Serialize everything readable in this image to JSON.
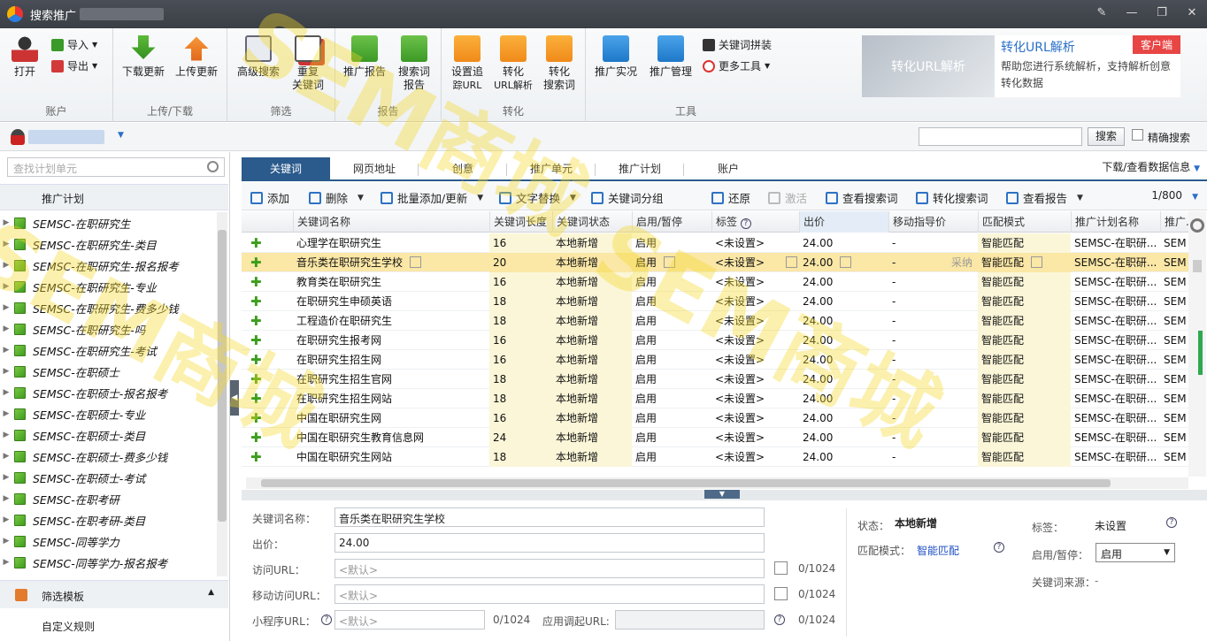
{
  "window": {
    "title": "搜索推广",
    "controls": [
      "edit",
      "minimize",
      "restore",
      "close"
    ]
  },
  "ribbon": {
    "groups": [
      {
        "label": "账户",
        "buttons": [
          "打开"
        ],
        "small": [
          "导入",
          "导出"
        ]
      },
      {
        "label": "上传/下载",
        "buttons": [
          "下载更新",
          "上传更新"
        ]
      },
      {
        "label": "筛选",
        "buttons": [
          "高级搜索",
          "重复关键词"
        ]
      },
      {
        "label": "报告",
        "buttons": [
          "推广报告",
          "搜索词报告"
        ]
      },
      {
        "label": "转化",
        "buttons": [
          "设置追踪URL",
          "转化URL解析",
          "转化搜索词"
        ]
      },
      {
        "label": "工具",
        "buttons": [
          "推广实况",
          "推广管理"
        ],
        "small": [
          "关键词拼装",
          "更多工具"
        ]
      }
    ],
    "btn": {
      "open": "打开",
      "import": "导入",
      "export": "导出",
      "download": "下载更新",
      "upload": "上传更新",
      "adv_search_1": "高级搜索",
      "dup_1": "重复",
      "dup_2": "关键词",
      "report": "推广报告",
      "sw_report_1": "搜索词",
      "sw_report_2": "报告",
      "track_1": "设置追",
      "track_2": "踪URL",
      "conv_url_1": "转化",
      "conv_url_2": "URL解析",
      "conv_sw_1": "转化",
      "conv_sw_2": "搜索词",
      "live": "推广实况",
      "manage": "推广管理",
      "kw_assemble": "关键词拼装",
      "more_tools": "更多工具"
    },
    "labels": {
      "account": "账户",
      "updown": "上传/下载",
      "filter": "筛选",
      "report": "报告",
      "convert": "转化",
      "tools": "工具"
    },
    "promo": {
      "image_text": "转化URL解析",
      "title": "转化URL解析",
      "badge": "客户端",
      "text": "帮助您进行系统解析，支持解析创意转化数据"
    }
  },
  "account_bar": {
    "search_button": "搜索",
    "exact_label": "精确搜索"
  },
  "sidebar": {
    "search_placeholder": "查找计划单元",
    "plan_header": "推广计划",
    "plans": [
      "SEMSC-在职研究生",
      "SEMSC-在职研究生-类目",
      "SEMSC-在职研究生-报名报考",
      "SEMSC-在职研究生-专业",
      "SEMSC-在职研究生-费多少钱",
      "SEMSC-在职研究生-吗",
      "SEMSC-在职研究生-考试",
      "SEMSC-在职硕士",
      "SEMSC-在职硕士-报名报考",
      "SEMSC-在职硕士-专业",
      "SEMSC-在职硕士-类目",
      "SEMSC-在职硕士-费多少钱",
      "SEMSC-在职硕士-考试",
      "SEMSC-在职考研",
      "SEMSC-在职考研-类目",
      "SEMSC-同等学力",
      "SEMSC-同等学力-报名报考"
    ],
    "filter_header": "筛选模板",
    "custom_rule": "自定义规则"
  },
  "tabs": [
    {
      "label": "关键词",
      "active": true
    },
    {
      "label": "网页地址"
    },
    {
      "label": "创意"
    },
    {
      "label": "推广单元"
    },
    {
      "label": "推广计划"
    },
    {
      "label": "账户"
    }
  ],
  "tabs_right": "下载/查看数据信息",
  "toolbar": {
    "add": "添加",
    "delete": "删除",
    "batch_add": "批量添加/更新",
    "text_replace": "文字替换",
    "kw_group": "关键词分组",
    "restore": "还原",
    "activate": "激活",
    "view_sw": "查看搜索词",
    "conv_sw": "转化搜索词",
    "view_report": "查看报告",
    "pager": "1/800"
  },
  "grid": {
    "headers": [
      "关键词名称",
      "关键词长度",
      "关键词状态",
      "启用/暂停",
      "标签",
      "出价",
      "移动指导价",
      "匹配模式",
      "推广计划名称",
      "推广..."
    ],
    "rows": [
      {
        "kw": "心理学在职研究生",
        "len": "16",
        "status": "本地新增",
        "enabled": "启用",
        "tag": "<未设置>",
        "bid": "24.00",
        "mobile": "-",
        "match": "智能匹配",
        "plan": "SEMSC-在职研...",
        "unit": "SEM"
      },
      {
        "kw": "音乐类在职研究生学校",
        "len": "20",
        "status": "本地新增",
        "enabled": "启用",
        "tag": "<未设置>",
        "bid": "24.00",
        "mobile": "-",
        "match": "智能匹配",
        "plan": "SEMSC-在职研...",
        "unit": "SEM",
        "selected": true,
        "extra": "采纳"
      },
      {
        "kw": "教育类在职研究生",
        "len": "16",
        "status": "本地新增",
        "enabled": "启用",
        "tag": "<未设置>",
        "bid": "24.00",
        "mobile": "-",
        "match": "智能匹配",
        "plan": "SEMSC-在职研...",
        "unit": "SEM"
      },
      {
        "kw": "在职研究生申硕英语",
        "len": "18",
        "status": "本地新增",
        "enabled": "启用",
        "tag": "<未设置>",
        "bid": "24.00",
        "mobile": "-",
        "match": "智能匹配",
        "plan": "SEMSC-在职研...",
        "unit": "SEM"
      },
      {
        "kw": "工程造价在职研究生",
        "len": "18",
        "status": "本地新增",
        "enabled": "启用",
        "tag": "<未设置>",
        "bid": "24.00",
        "mobile": "-",
        "match": "智能匹配",
        "plan": "SEMSC-在职研...",
        "unit": "SEM"
      },
      {
        "kw": "在职研究生报考网",
        "len": "16",
        "status": "本地新增",
        "enabled": "启用",
        "tag": "<未设置>",
        "bid": "24.00",
        "mobile": "-",
        "match": "智能匹配",
        "plan": "SEMSC-在职研...",
        "unit": "SEM"
      },
      {
        "kw": "在职研究生招生网",
        "len": "16",
        "status": "本地新增",
        "enabled": "启用",
        "tag": "<未设置>",
        "bid": "24.00",
        "mobile": "-",
        "match": "智能匹配",
        "plan": "SEMSC-在职研...",
        "unit": "SEM"
      },
      {
        "kw": "在职研究生招生官网",
        "len": "18",
        "status": "本地新增",
        "enabled": "启用",
        "tag": "<未设置>",
        "bid": "24.00",
        "mobile": "-",
        "match": "智能匹配",
        "plan": "SEMSC-在职研...",
        "unit": "SEM"
      },
      {
        "kw": "在职研究生招生网站",
        "len": "18",
        "status": "本地新增",
        "enabled": "启用",
        "tag": "<未设置>",
        "bid": "24.00",
        "mobile": "-",
        "match": "智能匹配",
        "plan": "SEMSC-在职研...",
        "unit": "SEM"
      },
      {
        "kw": "中国在职研究生网",
        "len": "16",
        "status": "本地新增",
        "enabled": "启用",
        "tag": "<未设置>",
        "bid": "24.00",
        "mobile": "-",
        "match": "智能匹配",
        "plan": "SEMSC-在职研...",
        "unit": "SEM"
      },
      {
        "kw": "中国在职研究生教育信息网",
        "len": "24",
        "status": "本地新增",
        "enabled": "启用",
        "tag": "<未设置>",
        "bid": "24.00",
        "mobile": "-",
        "match": "智能匹配",
        "plan": "SEMSC-在职研...",
        "unit": "SEM"
      },
      {
        "kw": "中国在职研究生网站",
        "len": "18",
        "status": "本地新增",
        "enabled": "启用",
        "tag": "<未设置>",
        "bid": "24.00",
        "mobile": "-",
        "match": "智能匹配",
        "plan": "SEMSC-在职研...",
        "unit": "SEM"
      }
    ]
  },
  "detail": {
    "kw_label": "关键词名称：",
    "kw_value": "音乐类在职研究生学校",
    "bid_label": "出价：",
    "bid_value": "24.00",
    "url_label": "访问URL：",
    "url_ph": "<默认>",
    "url_count": "0/1024",
    "murl_label": "移动访问URL：",
    "murl_ph": "<默认>",
    "murl_count": "0/1024",
    "mini_label": "小程序URL：",
    "mini_ph": "<默认>",
    "mini_count": "0/1024",
    "app_label": "应用调起URL:",
    "app_count": "0/1024",
    "status_label": "状态：",
    "status_value": "本地新增",
    "match_label": "匹配模式：",
    "match_value": "智能匹配",
    "tag_label": "标签：",
    "tag_value": "未设置",
    "enable_label": "启用/暂停：",
    "enable_value": "启用",
    "source_label": "关键词来源："
  },
  "watermark": {
    "text": "SEM商城"
  }
}
